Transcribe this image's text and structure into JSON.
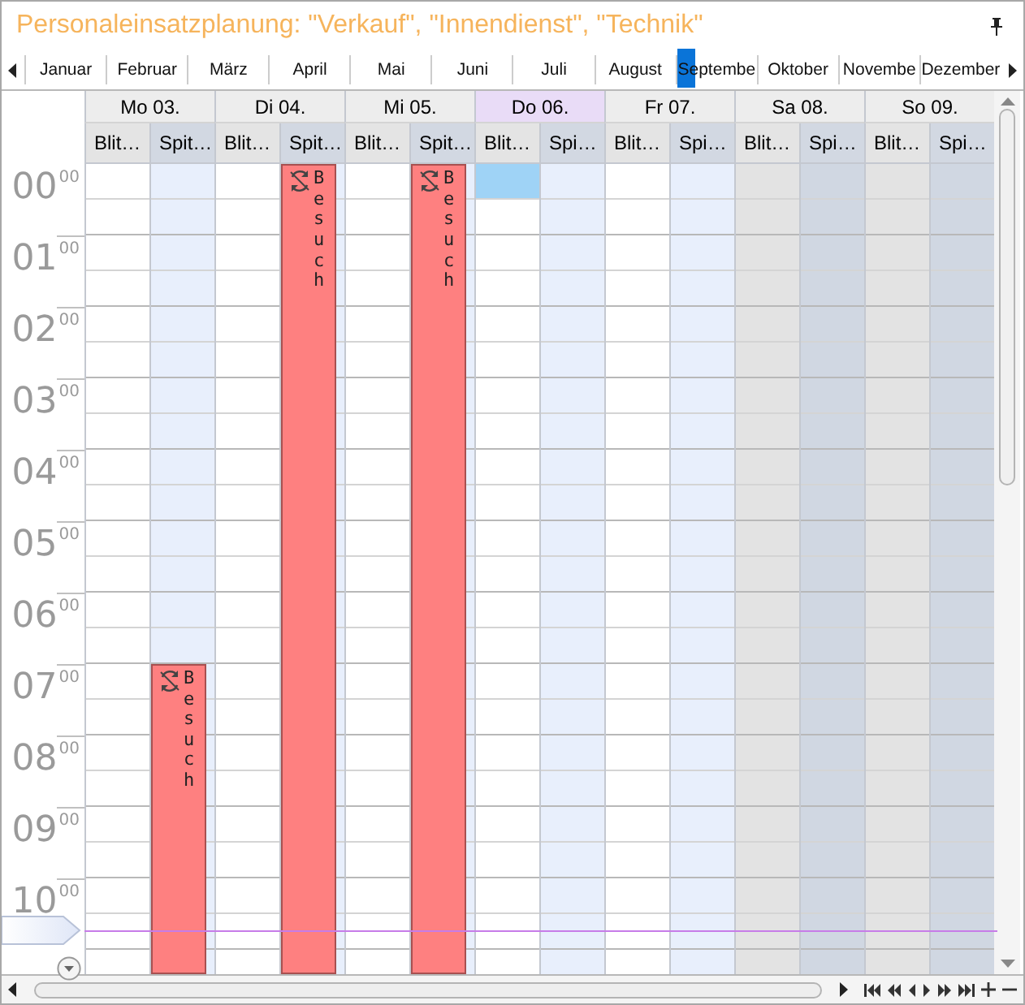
{
  "window": {
    "title": "Personaleinsatzplanung: \"Verkauf\", \"Innendienst\", \"Technik\""
  },
  "months": [
    {
      "label": "Januar",
      "selected": false
    },
    {
      "label": "Februar",
      "selected": false
    },
    {
      "label": "März",
      "selected": false
    },
    {
      "label": "April",
      "selected": false
    },
    {
      "label": "Mai",
      "selected": false
    },
    {
      "label": "Juni",
      "selected": false
    },
    {
      "label": "Juli",
      "selected": false
    },
    {
      "label": "August",
      "selected": false
    },
    {
      "label": "Septembe",
      "selected": true
    },
    {
      "label": "Oktober",
      "selected": false
    },
    {
      "label": "Novembe",
      "selected": false
    },
    {
      "label": "Dezember",
      "selected": false
    }
  ],
  "hours": [
    {
      "hour": "00",
      "minutes": "00"
    },
    {
      "hour": "01",
      "minutes": "00"
    },
    {
      "hour": "02",
      "minutes": "00"
    },
    {
      "hour": "03",
      "minutes": "00"
    },
    {
      "hour": "04",
      "minutes": "00"
    },
    {
      "hour": "05",
      "minutes": "00"
    },
    {
      "hour": "06",
      "minutes": "00"
    },
    {
      "hour": "07",
      "minutes": "00"
    },
    {
      "hour": "08",
      "minutes": "00"
    },
    {
      "hour": "09",
      "minutes": "00"
    },
    {
      "hour": "10",
      "minutes": "00"
    }
  ],
  "days": [
    {
      "label": "Mo 03.",
      "today": false,
      "weekend": false,
      "resources": [
        {
          "name": "Blit…"
        },
        {
          "name": "Spit…",
          "appointment": {
            "subject": "Besuch",
            "level": 0.383,
            "recurring": true
          }
        }
      ]
    },
    {
      "label": "Di 04.",
      "today": false,
      "weekend": false,
      "resources": [
        {
          "name": "Blit…"
        },
        {
          "name": "Spit…",
          "appointment": {
            "subject": "Besuch",
            "level": 1,
            "recurring": true
          }
        }
      ]
    },
    {
      "label": "Mi 05.",
      "today": false,
      "weekend": false,
      "resources": [
        {
          "name": "Blit…"
        },
        {
          "name": "Spit…",
          "appointment": {
            "subject": "Besuch",
            "level": 1,
            "recurring": true
          }
        }
      ]
    },
    {
      "label": "Do 06.",
      "today": true,
      "weekend": false,
      "resources": [
        {
          "name": "Blit…",
          "top_slot_selected": true
        },
        {
          "name": "Spi…"
        }
      ]
    },
    {
      "label": "Fr 07.",
      "today": false,
      "weekend": false,
      "resources": [
        {
          "name": "Blit…"
        },
        {
          "name": "Spi…"
        }
      ]
    },
    {
      "label": "Sa 08.",
      "today": false,
      "weekend": true,
      "resources": [
        {
          "name": "Blit…"
        },
        {
          "name": "Spi…"
        }
      ]
    },
    {
      "label": "So 09.",
      "today": false,
      "weekend": true,
      "resources": [
        {
          "name": "Blit…"
        },
        {
          "name": "Spi…"
        }
      ]
    }
  ]
}
